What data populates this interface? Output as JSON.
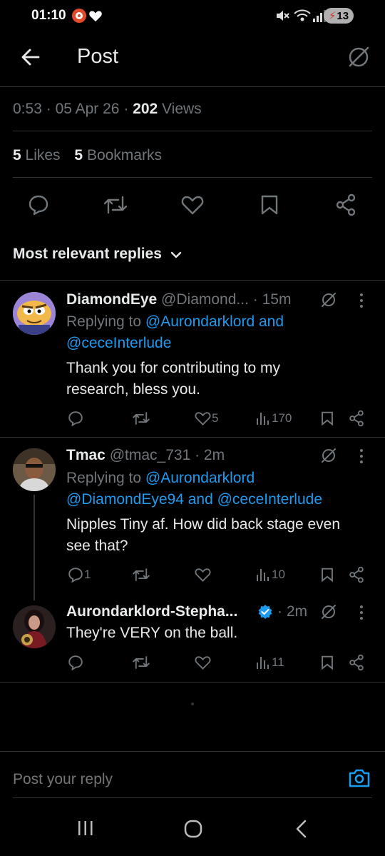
{
  "status_bar": {
    "time": "01:10",
    "battery": "13"
  },
  "header": {
    "title": "Post"
  },
  "meta": {
    "time": "0:53",
    "date": "05 Apr 26",
    "views_count": "202",
    "views_label": "Views",
    "dot": "·"
  },
  "stats": {
    "likes_count": "5",
    "likes_label": "Likes",
    "bookmarks_count": "5",
    "bookmarks_label": "Bookmarks"
  },
  "sort": {
    "label": "Most relevant replies"
  },
  "replies": [
    {
      "name": "DiamondEye",
      "handle": "@Diamond...",
      "time": "· 15m",
      "replying_prefix": "Replying to",
      "replying_line1": "@Aurondarklord and",
      "replying_line2": "@ceceInterlude",
      "text_line1": "Thank you for contributing to my",
      "text_line2": "research, bless you.",
      "likes": "5",
      "views": "170"
    },
    {
      "name": "Tmac",
      "handle": "@tmac_731 · 2m",
      "replying_prefix": "Replying to",
      "replying_line1": "@Aurondarklord",
      "replying_line2": "@DiamondEye94 and @ceceInterlude",
      "text_line1": "Nipples Tiny af. How did back stage even",
      "text_line2": "see that?",
      "replies": "1",
      "views": "10"
    },
    {
      "name": "Aurondarklord-Stepha...",
      "time": "· 2m",
      "text": "They're VERY on the ball.",
      "views": "11"
    }
  ],
  "composer": {
    "placeholder": "Post your reply"
  },
  "colors": {
    "background": "#000000",
    "link": "#1d9bf0",
    "muted": "#71767b",
    "separator": "#2f3336",
    "verified": "#1d9bf0"
  }
}
